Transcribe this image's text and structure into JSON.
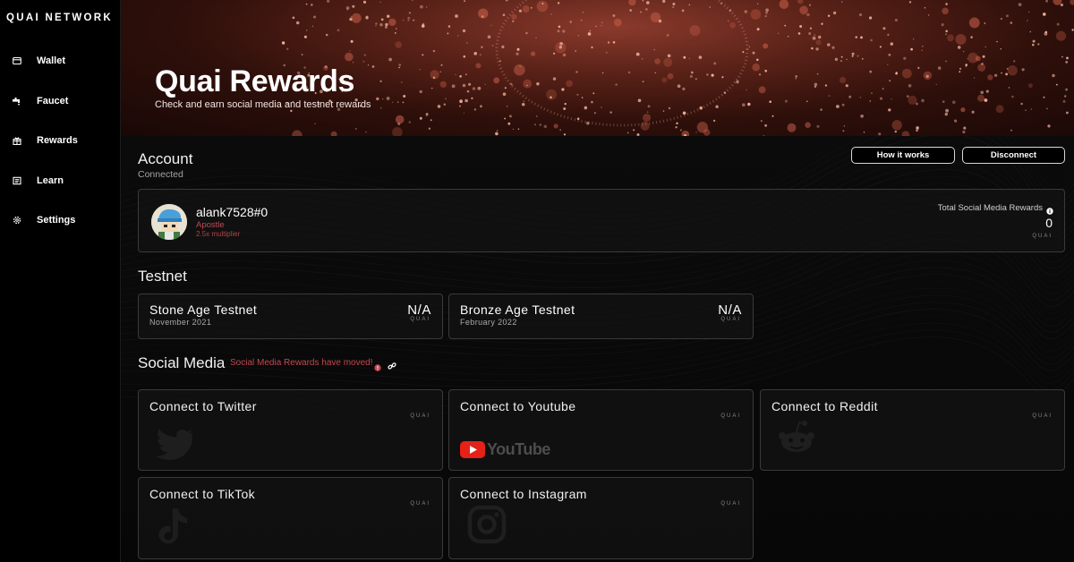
{
  "app": {
    "logo": "QUAI NETWORK"
  },
  "sidebar": {
    "items": [
      {
        "label": "Wallet",
        "icon": "wallet-icon"
      },
      {
        "label": "Faucet",
        "icon": "faucet-icon"
      },
      {
        "label": "Rewards",
        "icon": "gift-icon"
      },
      {
        "label": "Learn",
        "icon": "book-icon"
      },
      {
        "label": "Settings",
        "icon": "gear-icon"
      }
    ]
  },
  "banner": {
    "title": "Quai Rewards",
    "subtitle": "Check and earn social media and testnet rewards"
  },
  "account": {
    "heading": "Account",
    "status": "Connected",
    "how_it_works_label": "How it works",
    "disconnect_label": "Disconnect",
    "username": "alank7528#0",
    "role": "Apostle",
    "multiplier": "2.5x multiplier",
    "total_label": "Total Social Media Rewards",
    "total_value": "0",
    "brand_mark": "QUAI"
  },
  "testnet": {
    "heading": "Testnet",
    "items": [
      {
        "name": "Stone Age Testnet",
        "date": "November 2021",
        "value": "N/A",
        "brand_mark": "QUAI"
      },
      {
        "name": "Bronze Age Testnet",
        "date": "February 2022",
        "value": "N/A",
        "brand_mark": "QUAI"
      }
    ]
  },
  "social": {
    "heading": "Social Media",
    "notice": "Social Media Rewards have moved!",
    "cards": [
      {
        "label": "Connect to Twitter",
        "icon": "twitter-icon",
        "brand_mark": "QUAI"
      },
      {
        "label": "Connect to Youtube",
        "icon": "youtube-logo",
        "logo_text": "YouTube",
        "brand_mark": "QUAI"
      },
      {
        "label": "Connect to Reddit",
        "icon": "reddit-icon",
        "brand_mark": "QUAI"
      },
      {
        "label": "Connect to TikTok",
        "icon": "tiktok-icon",
        "brand_mark": "QUAI"
      },
      {
        "label": "Connect to Instagram",
        "icon": "instagram-icon",
        "brand_mark": "QUAI"
      }
    ]
  },
  "colors": {
    "accent_red": "#c44650",
    "banner_red": "#8a3a2c",
    "youtube_red": "#e62117"
  }
}
